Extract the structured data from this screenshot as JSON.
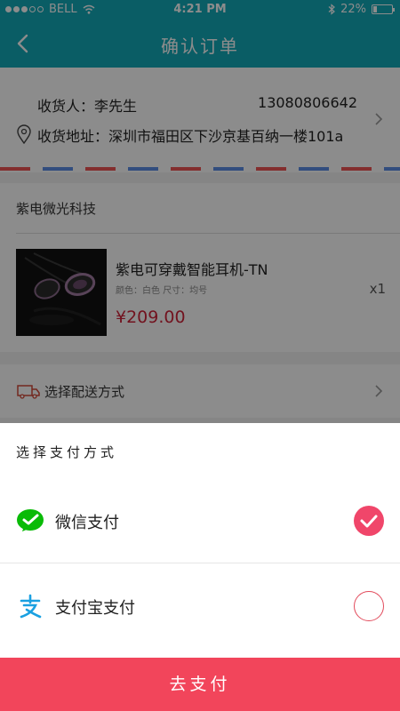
{
  "status_bar": {
    "carrier": "BELL",
    "time": "4:21 PM",
    "battery": "22%",
    "battery_level": 0.22
  },
  "nav": {
    "title": "确认订单"
  },
  "address": {
    "name_label": "收货人：李先生",
    "phone": "13080806642",
    "address_label": "收货地址：深圳市福田区下沙京基百纳一楼101a"
  },
  "shop": {
    "name": "紫电微光科技",
    "product": {
      "title": "紫电可穿戴智能耳机-TN",
      "spec": "颜色：白色  尺寸：均号",
      "price": "¥209.00",
      "quantity": "x1"
    }
  },
  "delivery": {
    "label": "选择配送方式"
  },
  "payment_sheet": {
    "title": "选择支付方式",
    "options": [
      {
        "label": "微信支付",
        "selected": true,
        "icon": "wechat-pay-icon",
        "color": "#09bb07"
      },
      {
        "label": "支付宝支付",
        "selected": false,
        "icon": "alipay-icon",
        "color": "#1aa0e1"
      }
    ]
  },
  "pay_button": {
    "label": "去支付"
  },
  "colors": {
    "nav": "#13a9b8",
    "accent": "#f2455b",
    "price": "#d0243a"
  }
}
